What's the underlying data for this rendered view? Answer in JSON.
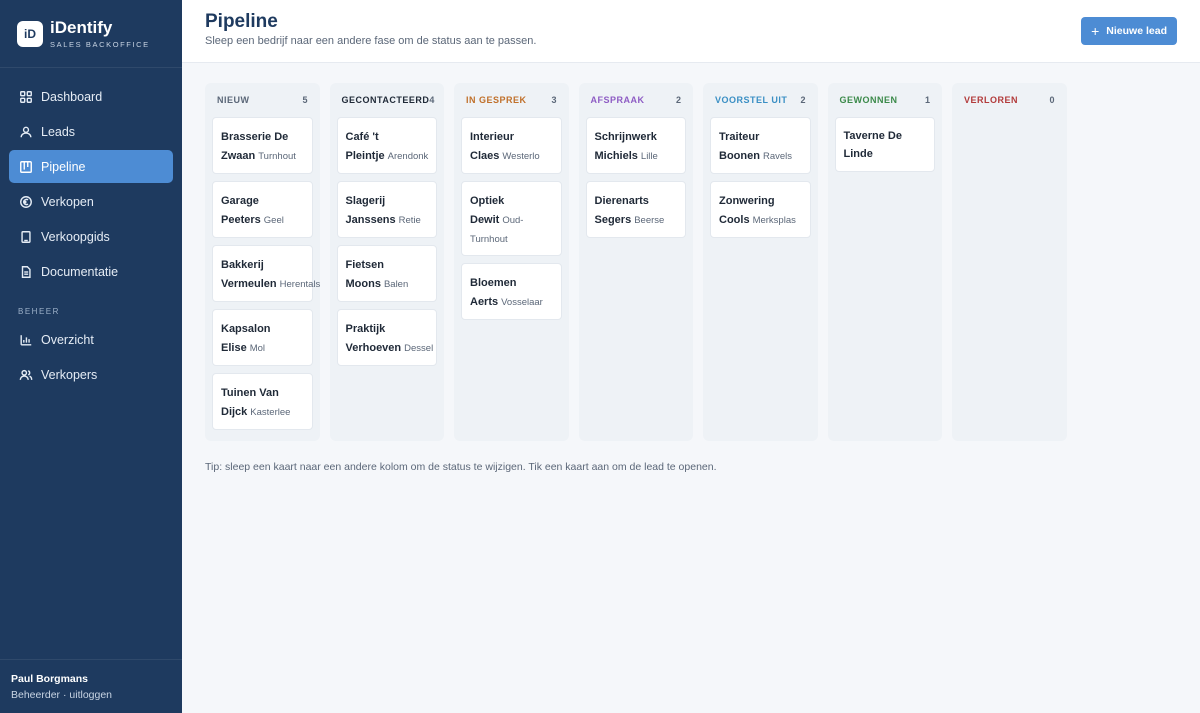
{
  "brand": {
    "logo": "iD",
    "name": "iDentify",
    "subtitle": "SALES BACKOFFICE"
  },
  "nav": {
    "items": [
      {
        "label": "Dashboard",
        "icon": "grid-icon",
        "active": false
      },
      {
        "label": "Leads",
        "icon": "user-icon",
        "active": false
      },
      {
        "label": "Pipeline",
        "icon": "kanban-icon",
        "active": true
      },
      {
        "label": "Verkopen",
        "icon": "euro-icon",
        "active": false
      },
      {
        "label": "Verkoopgids",
        "icon": "book-icon",
        "active": false
      },
      {
        "label": "Documentatie",
        "icon": "document-icon",
        "active": false
      }
    ],
    "section_label": "BEHEER",
    "admin_items": [
      {
        "label": "Overzicht",
        "icon": "bar-chart-icon"
      },
      {
        "label": "Verkopers",
        "icon": "users-icon"
      }
    ]
  },
  "user": {
    "name": "Paul Borgmans",
    "role": "Beheerder",
    "separator": " · ",
    "logout": "uitloggen"
  },
  "header": {
    "title": "Pipeline",
    "subtitle": "Sleep een bedrijf naar een andere fase om de status aan te passen.",
    "new_lead_label": "Nieuwe lead"
  },
  "columns": [
    {
      "title": "NIEUW",
      "count": "5",
      "color": "#5b6778",
      "cards": [
        {
          "name": "Brasserie De Zwaan",
          "city": "Turnhout"
        },
        {
          "name": "Garage Peeters",
          "city": "Geel"
        },
        {
          "name": "Bakkerij Vermeulen",
          "city": "Herentals"
        },
        {
          "name": "Kapsalon Elise",
          "city": "Mol"
        },
        {
          "name": "Tuinen Van Dijck",
          "city": "Kasterlee"
        }
      ]
    },
    {
      "title": "GECONTACTEERD",
      "count": "4",
      "color": "#1f2937",
      "cards": [
        {
          "name": "Café 't Pleintje",
          "city": "Arendonk"
        },
        {
          "name": "Slagerij Janssens",
          "city": "Retie"
        },
        {
          "name": "Fietsen Moons",
          "city": "Balen"
        },
        {
          "name": "Praktijk Verhoeven",
          "city": "Dessel"
        }
      ]
    },
    {
      "title": "IN GESPREK",
      "count": "3",
      "color": "#c0702a",
      "cards": [
        {
          "name": "Interieur Claes",
          "city": "Westerlo"
        },
        {
          "name": "Optiek Dewit",
          "city": "Oud-Turnhout"
        },
        {
          "name": "Bloemen Aerts",
          "city": "Vosselaar"
        }
      ]
    },
    {
      "title": "AFSPRAAK",
      "count": "2",
      "color": "#8e5cc4",
      "cards": [
        {
          "name": "Schrijnwerk Michiels",
          "city": "Lille"
        },
        {
          "name": "Dierenarts Segers",
          "city": "Beerse"
        }
      ]
    },
    {
      "title": "VOORSTEL UIT",
      "count": "2",
      "color": "#3a8fc4",
      "cards": [
        {
          "name": "Traiteur Boonen",
          "city": "Ravels"
        },
        {
          "name": "Zonwering Cools",
          "city": "Merksplas"
        }
      ]
    },
    {
      "title": "GEWONNEN",
      "count": "1",
      "color": "#3b8a4a",
      "cards": [
        {
          "name": "Taverne De Linde",
          "city": ""
        }
      ]
    },
    {
      "title": "VERLOREN",
      "count": "0",
      "color": "#b23b3b",
      "cards": []
    }
  ],
  "tip": "Tip: sleep een kaart naar een andere kolom om de status te wijzigen. Tik een kaart aan om de lead te openen."
}
